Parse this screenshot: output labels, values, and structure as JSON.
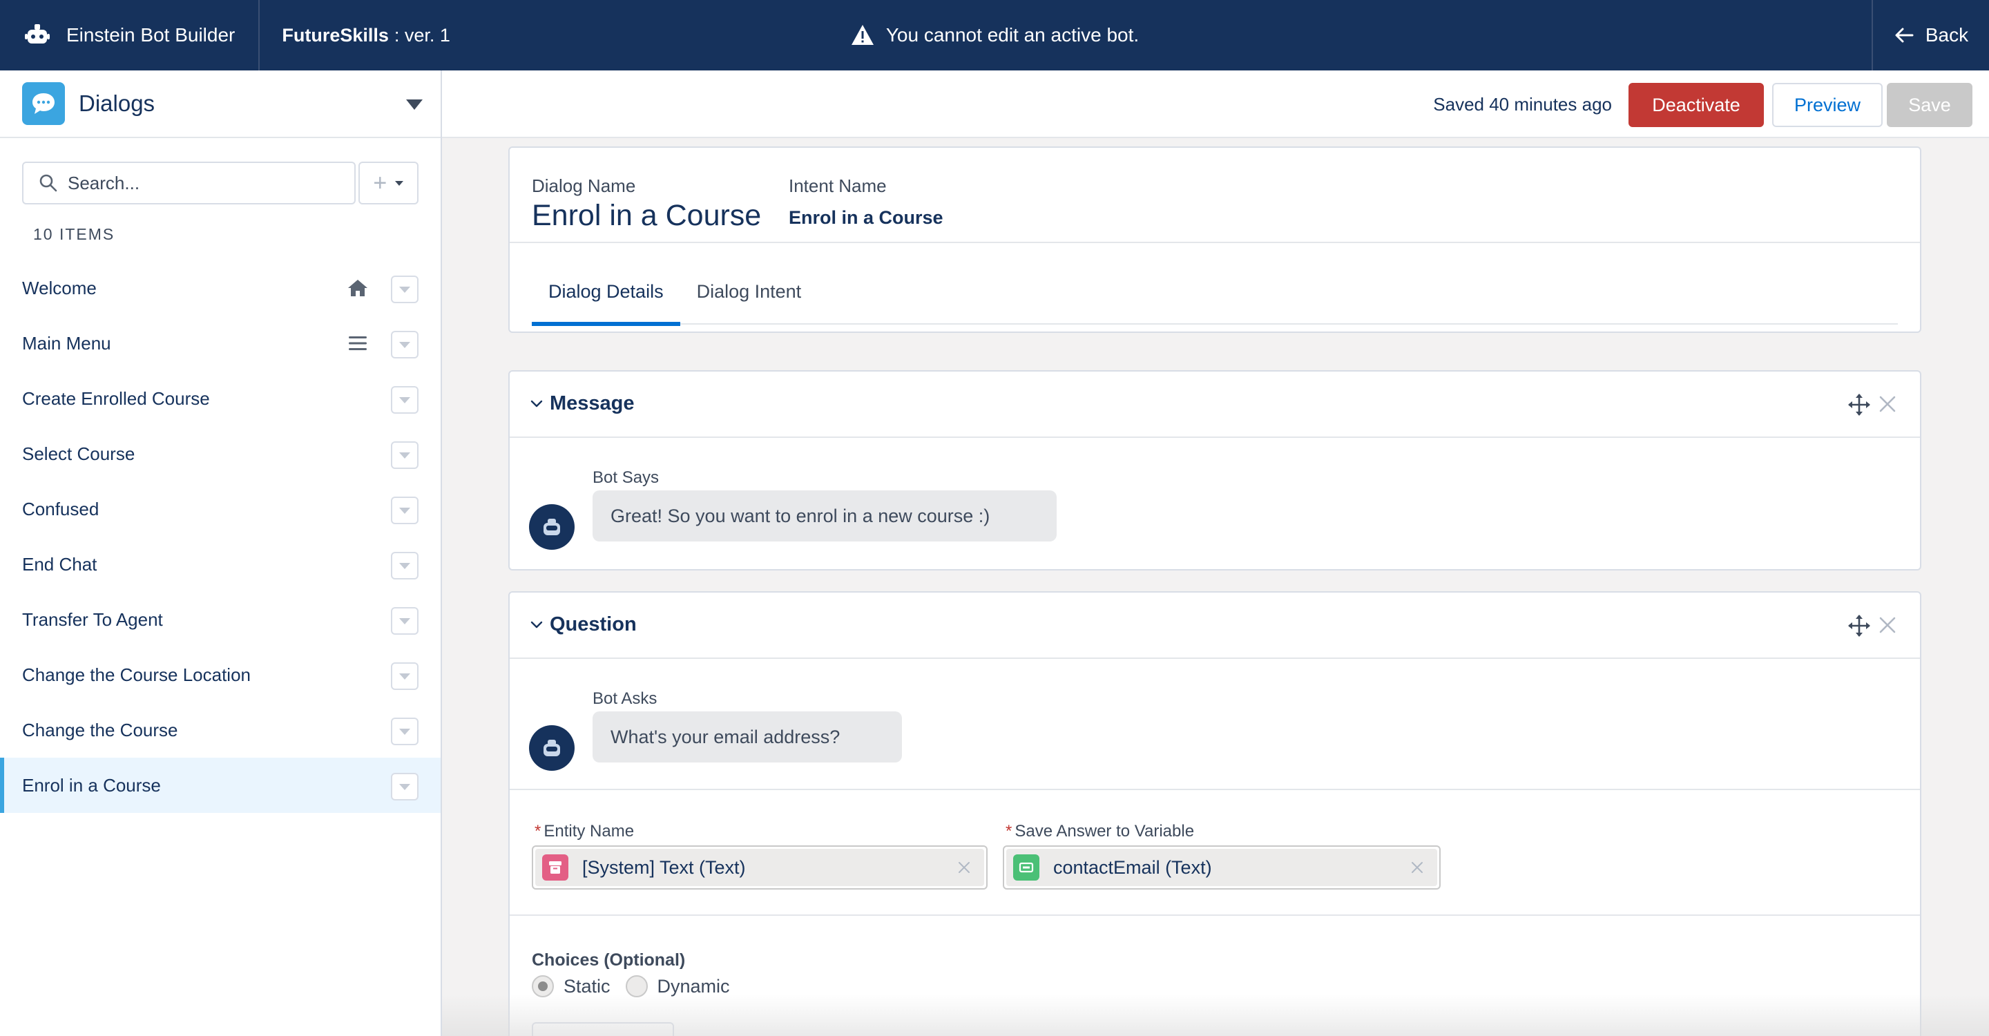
{
  "topbar": {
    "app_name": "Einstein Bot Builder",
    "bot_name": "FutureSkills",
    "bot_version": ": ver. 1",
    "warning": "You cannot edit an active bot.",
    "back_label": "Back"
  },
  "sidebar": {
    "title": "Dialogs",
    "search_placeholder": "Search...",
    "add_symbol": "+",
    "count_label": "10 ITEMS",
    "items": [
      {
        "label": "Welcome",
        "icon": "home-icon"
      },
      {
        "label": "Main Menu",
        "icon": "menu-lines-icon"
      },
      {
        "label": "Create Enrolled Course"
      },
      {
        "label": "Select Course"
      },
      {
        "label": "Confused"
      },
      {
        "label": "End Chat"
      },
      {
        "label": "Transfer To Agent"
      },
      {
        "label": "Change the Course Location"
      },
      {
        "label": "Change the Course"
      },
      {
        "label": "Enrol in a Course",
        "active": true
      }
    ]
  },
  "header": {
    "saved_text": "Saved 40 minutes ago",
    "deactivate_label": "Deactivate",
    "preview_label": "Preview",
    "save_label": "Save"
  },
  "dialog": {
    "name_label": "Dialog Name",
    "name": "Enrol in a Course",
    "intent_label": "Intent Name",
    "intent": "Enrol in a Course",
    "tabs": [
      {
        "label": "Dialog Details",
        "active": true
      },
      {
        "label": "Dialog Intent"
      }
    ]
  },
  "message": {
    "title": "Message",
    "bot_label": "Bot Says",
    "text": "Great! So you want to enrol in a new course :)"
  },
  "question": {
    "title": "Question",
    "bot_label": "Bot Asks",
    "text": "What's your email address?",
    "entity_label": "Entity Name",
    "entity_value": "[System] Text (Text)",
    "variable_label": "Save Answer to Variable",
    "variable_value": "contactEmail (Text)",
    "required_mark": "*",
    "choices_label": "Choices (Optional)",
    "choice_options": [
      "Static",
      "Dynamic"
    ],
    "selected_choice": "Static"
  },
  "colors": {
    "topbar_bg": "#16325c",
    "deactivate": "#c23934",
    "link_blue": "#0070d2",
    "active_accent": "#3ba5e0",
    "entity_icon": "#e35f85",
    "variable_icon": "#4bc076"
  }
}
